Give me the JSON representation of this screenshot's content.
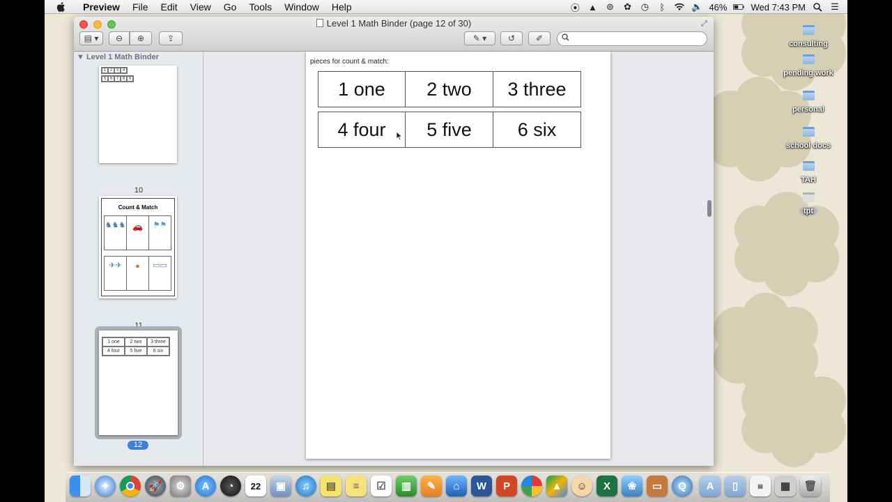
{
  "menubar": {
    "app_name": "Preview",
    "items": [
      "File",
      "Edit",
      "View",
      "Go",
      "Tools",
      "Window",
      "Help"
    ],
    "battery": "46%",
    "clock": "Wed 7:43 PM"
  },
  "window": {
    "title": "Level 1 Math Binder (page 12 of 30)",
    "search_placeholder": ""
  },
  "sidebar": {
    "header": "Level 1 Math Binder",
    "thumbnails": [
      {
        "page": "10",
        "cells": [
          "1",
          "2",
          "3",
          "4",
          "5",
          "6",
          "7",
          "8",
          "9"
        ]
      },
      {
        "page": "11",
        "title": "Count & Match"
      },
      {
        "page": "12",
        "cells": [
          "1 one",
          "2 two",
          "3 three",
          "4 four",
          "5 five",
          "6 six"
        ],
        "selected": true
      }
    ]
  },
  "document": {
    "page_header": "pieces for count & match:",
    "cards_row1": [
      "1 one",
      "2 two",
      "3 three"
    ],
    "cards_row2": [
      "4 four",
      "5 five",
      "6 six"
    ]
  },
  "desktop": {
    "folders": [
      "consulting",
      "pending work",
      "personal",
      "school docs",
      "TAH",
      "tpt"
    ]
  },
  "dock": {
    "icons": [
      "finder-icon",
      "safari-icon",
      "chrome-icon",
      "launchpad-icon",
      "system-preferences-icon",
      "app-store-icon",
      "dashboard-icon",
      "calendar-icon",
      "preview-icon",
      "itunes-icon",
      "stickies-icon",
      "notes-icon",
      "reminders-icon",
      "numbers-icon",
      "pages-icon",
      "keynote-icon",
      "word-icon",
      "powerpoint-icon",
      "picasa-icon",
      "google-drive-icon",
      "smile-icon",
      "excel-icon",
      "iphoto-icon",
      "presentation-icon",
      "quicktime-icon",
      "applications-folder-icon",
      "documents-folder-icon",
      "docs-stack-icon",
      "screenshots-stack-icon",
      "trash-icon"
    ],
    "calendar_day": "22"
  },
  "colors": {
    "accent": "#3f7fd6",
    "desktop_bg": "#ece7d7",
    "flower": "#d6cfb4"
  }
}
